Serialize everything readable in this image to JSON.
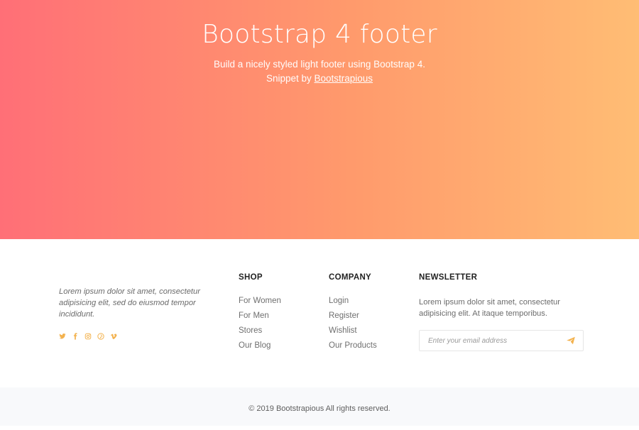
{
  "hero": {
    "title": "Bootstrap 4 footer",
    "subtitle": "Build a nicely styled light footer using Bootstrap 4.",
    "snippet_prefix": "Snippet by",
    "snippet_link": "Bootstrapious"
  },
  "footer": {
    "about_text": "Lorem ipsum dolor sit amet, consectetur adipisicing elit, sed do eiusmod tempor incididunt.",
    "social_icons": [
      "twitter-icon",
      "facebook-icon",
      "instagram-icon",
      "pinterest-icon",
      "vimeo-icon"
    ],
    "shop": {
      "heading": "SHOP",
      "items": [
        "For Women",
        "For Men",
        "Stores",
        "Our Blog"
      ]
    },
    "company": {
      "heading": "COMPANY",
      "items": [
        "Login",
        "Register",
        "Wishlist",
        "Our Products"
      ]
    },
    "newsletter": {
      "heading": "NEWSLETTER",
      "text": "Lorem ipsum dolor sit amet, consectetur adipisicing elit. At itaque temporibus.",
      "email_placeholder": "Enter your email address",
      "email_value": ""
    }
  },
  "bottom": {
    "copyright": "© 2019 Bootstrapious All rights reserved."
  },
  "colors": {
    "gradient_start": "#ff6f77",
    "gradient_end": "#ffbd74",
    "accent": "#f3b24e"
  }
}
